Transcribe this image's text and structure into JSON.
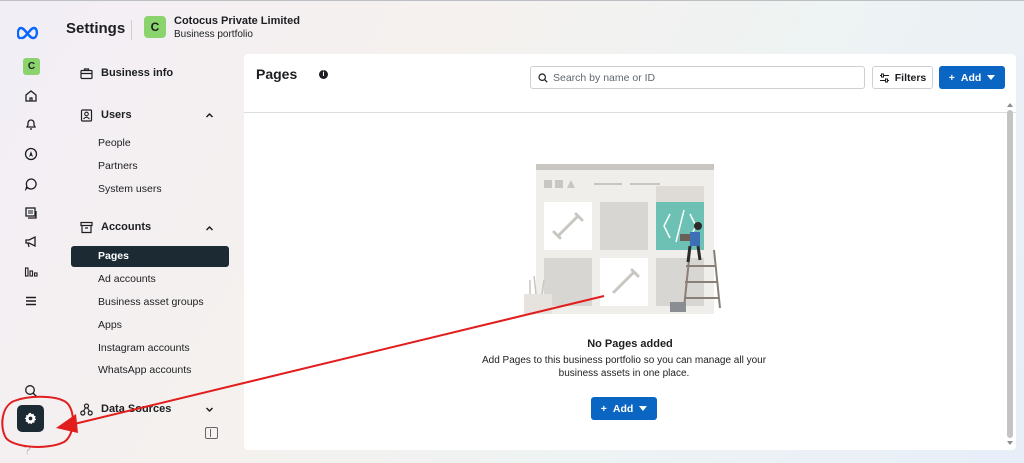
{
  "header": {
    "title": "Settings",
    "avatar_letter": "C",
    "org_name": "Cotocus Private Limited",
    "org_subtitle": "Business portfolio"
  },
  "rail": {
    "avatar_letter": "C",
    "icons": [
      "home-icon",
      "bell-icon",
      "compass-icon",
      "chat-icon",
      "pages-icon",
      "megaphone-icon",
      "analytics-icon",
      "menu-icon",
      "search-icon",
      "settings-icon",
      "help-icon"
    ],
    "help_label": "?"
  },
  "sidebar": {
    "business_info": "Business info",
    "users": {
      "label": "Users",
      "items": [
        "People",
        "Partners",
        "System users"
      ]
    },
    "accounts": {
      "label": "Accounts",
      "items": [
        "Pages",
        "Ad accounts",
        "Business asset groups",
        "Apps",
        "Instagram accounts",
        "WhatsApp accounts"
      ],
      "active": "Pages"
    },
    "data_sources": {
      "label": "Data Sources"
    }
  },
  "main": {
    "title": "Pages",
    "info_mark": "i",
    "search_placeholder": "Search by name or ID",
    "filters_label": "Filters",
    "add_label": "Add",
    "empty_title": "No Pages added",
    "empty_description": "Add Pages to this business portfolio so you can manage all your business assets in one place.",
    "empty_add_label": "Add"
  },
  "colors": {
    "accent": "#0a66c2",
    "dark": "#1c2b33",
    "avatar": "#8bd36c",
    "annotation": "#e11d1d"
  }
}
